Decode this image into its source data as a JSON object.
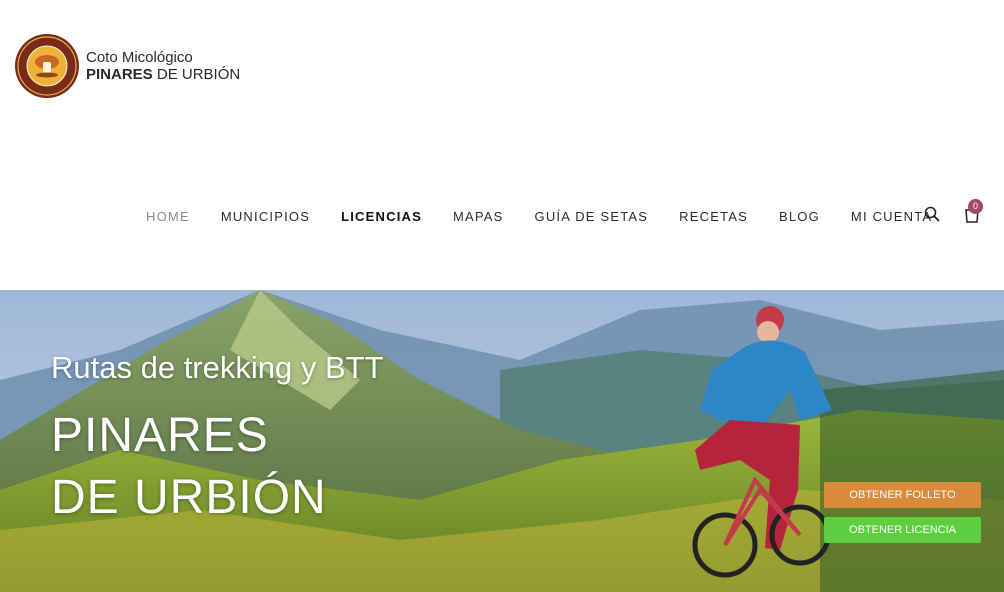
{
  "logo": {
    "line1": "Coto Micológico",
    "line2_bold": "PINARES",
    "line2_rest": " DE URBIÓN",
    "seal_text_top": "COTO MICOLÓGICO",
    "seal_text_bottom": "PINARES DE URBIÓN"
  },
  "nav": {
    "items": [
      {
        "label": "HOME",
        "state": "muted"
      },
      {
        "label": "MUNICIPIOS",
        "state": "normal"
      },
      {
        "label": "LICENCIAS",
        "state": "active"
      },
      {
        "label": "MAPAS",
        "state": "normal"
      },
      {
        "label": "GUÍA DE SETAS",
        "state": "normal"
      },
      {
        "label": "RECETAS",
        "state": "normal"
      },
      {
        "label": "BLOG",
        "state": "normal"
      },
      {
        "label": "MI CUENTA",
        "state": "normal"
      }
    ],
    "cart_count": "0",
    "icons": [
      "search-icon",
      "cart-icon"
    ]
  },
  "hero": {
    "subtitle": "Rutas de trekking y BTT",
    "title_line1": "PINARES",
    "title_line2": "DE URBIÓN",
    "btn_folleto": "OBTENER FOLLETO",
    "btn_licencia": "OBTENER LICENCIA"
  },
  "colors": {
    "badge": "#a4476a",
    "btn_folleto": "#d98a3a",
    "btn_licencia": "#5dcf3f"
  }
}
